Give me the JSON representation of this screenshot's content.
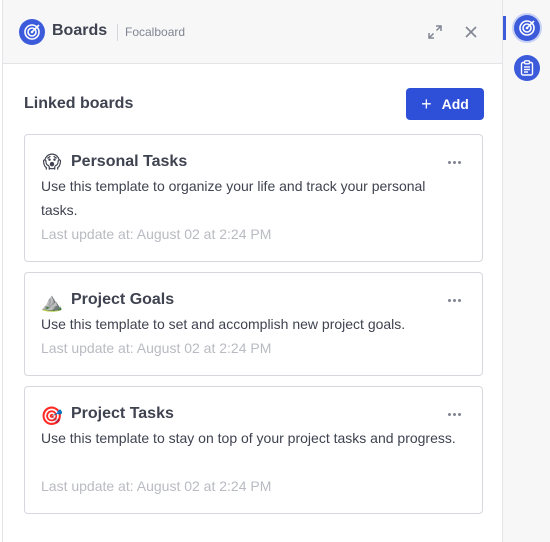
{
  "header": {
    "title": "Boards",
    "subtitle": "Focalboard"
  },
  "section": {
    "title": "Linked boards",
    "add_label": "Add"
  },
  "boards": [
    {
      "emoji": "😱",
      "title": "Personal Tasks",
      "description": "Use this template to organize your life and track your personal tasks.",
      "updated": "Last update at: August 02 at 2:24 PM"
    },
    {
      "emoji": "⛰️",
      "title": "Project Goals",
      "description": "Use this template to set and accomplish new project goals.",
      "updated": "Last update at: August 02 at 2:24 PM"
    },
    {
      "emoji": "🎯",
      "title": "Project Tasks",
      "description": "Use this template to stay on top of your project tasks and progress.",
      "updated": "Last update at: August 02 at 2:24 PM"
    }
  ],
  "rail": {
    "items": [
      "focalboard-icon",
      "clipboard-icon"
    ]
  },
  "colors": {
    "accent": "#2e4fd8",
    "logo": "#3b5bdb"
  }
}
